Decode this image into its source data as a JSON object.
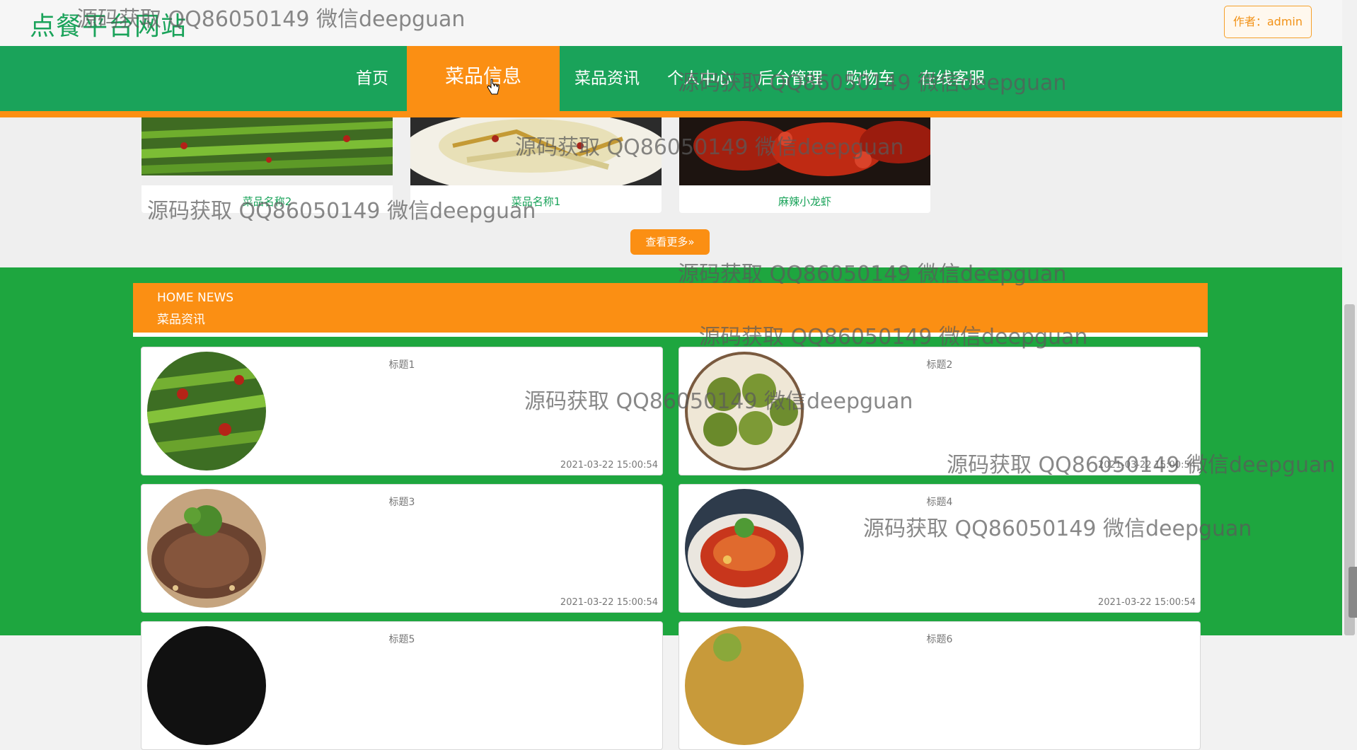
{
  "header": {
    "site_title": "点餐平台网站",
    "author_button": "作者：admin"
  },
  "nav": {
    "items": [
      {
        "label": "首页",
        "active": false
      },
      {
        "label": "菜品信息",
        "active": true
      },
      {
        "label": "菜品资讯",
        "active": false
      },
      {
        "label": "个人中心",
        "active": false
      },
      {
        "label": "后台管理",
        "active": false
      },
      {
        "label": "购物车",
        "active": false
      },
      {
        "label": "在线客服",
        "active": false
      }
    ]
  },
  "products": {
    "items": [
      {
        "name": "菜品名称2"
      },
      {
        "name": "菜品名称1"
      },
      {
        "name": "麻辣小龙虾"
      }
    ],
    "more_button": "查看更多"
  },
  "news": {
    "header_en": "HOME NEWS",
    "header_cn": "菜品资讯",
    "items": [
      {
        "title": "标题1",
        "date": "2021-03-22 15:00:54"
      },
      {
        "title": "标题2",
        "date": "2021-03-22 15:00:54"
      },
      {
        "title": "标题3",
        "date": "2021-03-22 15:00:54"
      },
      {
        "title": "标题4",
        "date": "2021-03-22 15:00:54"
      },
      {
        "title": "标题5",
        "date": ""
      },
      {
        "title": "标题6",
        "date": ""
      }
    ]
  },
  "watermark": "源码获取 QQ86050149 微信deepguan",
  "colors": {
    "brand_green": "#1aa35a",
    "news_green": "#1ea63f",
    "accent_orange": "#fb8f13"
  }
}
